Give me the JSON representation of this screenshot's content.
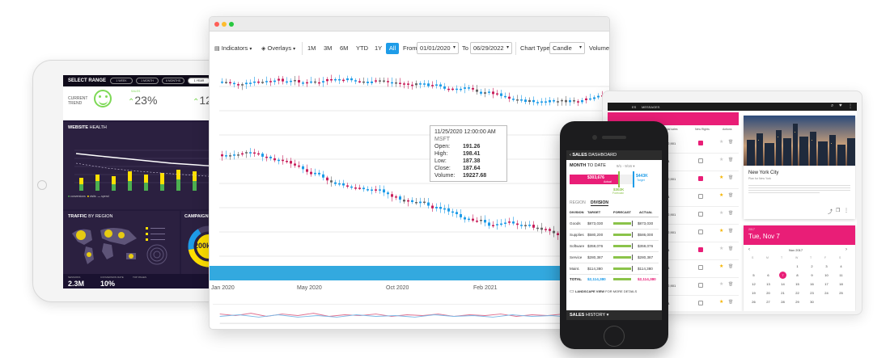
{
  "left_tablet": {
    "select_range": "SELECT RANGE",
    "ranges": [
      "1 WEEK",
      "1 MONTH",
      "6 MONTHS",
      "1 YEAR"
    ],
    "current_trend": "CURRENT TREND",
    "kpi1_label": "SALES",
    "kpi1_value": "23%",
    "kpi2_value": "12",
    "website_health_a": "WEBSITE",
    "website_health_b": "HEALTH",
    "legend": [
      "conversions",
      "visits",
      "spend"
    ],
    "traffic_a": "TRAFFIC",
    "traffic_b": "BY REGION",
    "campaign": "CAMPAIGN",
    "campaign_value": "200k",
    "footer": [
      {
        "label": "SESSIONS",
        "value": "2.3M"
      },
      {
        "label": "CONVERSION RATE",
        "value": "10%"
      },
      {
        "label": "TOP PAGES",
        "value": ""
      }
    ]
  },
  "browser": {
    "indicators": "Indicators",
    "overlays": "Overlays",
    "periods": [
      "1M",
      "3M",
      "6M",
      "YTD",
      "1Y",
      "All"
    ],
    "active_period": "All",
    "from_label": "From",
    "from_value": "01/01/2020",
    "to_label": "To",
    "to_value": "06/29/2022",
    "chart_type_label": "Chart Type",
    "chart_type_value": "Candle",
    "volume_label": "Volume",
    "tooltip": {
      "date": "11/25/2020 12:00:00 AM",
      "symbol": "MSFT",
      "rows": [
        {
          "k": "Open:",
          "v": "191.26"
        },
        {
          "k": "High:",
          "v": "198.41"
        },
        {
          "k": "Low:",
          "v": "187.38"
        },
        {
          "k": "Close:",
          "v": "187.64"
        },
        {
          "k": "Volume:",
          "v": "19227.68"
        }
      ]
    },
    "x_ticks": [
      "Jan 2020",
      "May 2020",
      "Oct 2020",
      "Feb 2021"
    ],
    "colors": {
      "up": "#1e9ce8",
      "down": "#c81e5a",
      "neutral": "#666666",
      "band": "#33a9df"
    }
  },
  "phone": {
    "header_a": "SALES",
    "header_b": "DASHBOARD",
    "month_a": "MONTH",
    "month_b": "TO DATE",
    "date_range": "9/1 - 9/16",
    "actual_value": "$303,676",
    "actual_label": "Actual",
    "target_value": "$443K",
    "target_label": "Target",
    "forecast_value": "$302K",
    "forecast_label": "Forecast",
    "region": "REGION",
    "division": "DIVISION",
    "cols": [
      "DIVISION",
      "TARGET",
      "FORECAST",
      "ACTUAL"
    ],
    "rows": [
      {
        "division": "Goods",
        "target": "$873,030",
        "actual": "$873,030"
      },
      {
        "division": "Supplies",
        "target": "$580,200",
        "actual": "$586,000"
      },
      {
        "division": "Software",
        "target": "$359,076",
        "actual": "$359,076"
      },
      {
        "division": "Service",
        "target": "$280,387",
        "actual": "$280,387"
      },
      {
        "division": "Maint.",
        "target": "$114,380",
        "actual": "$114,380"
      }
    ],
    "total_label": "TOTAL",
    "total_target": "$2,114,380",
    "total_actual": "$2,114,380",
    "landscape_note_a": "LANDSCAPE VIEW",
    "landscape_note_b": "FOR MORE DETAILS",
    "footer_a": "SALES",
    "footer_b": "HISTORY"
  },
  "right_tablet": {
    "topbar": [
      "ES",
      "MESSAGES"
    ],
    "cols": [
      "Total sales",
      "New Rights",
      "Actions"
    ],
    "rows": [
      {
        "v": "$2,901",
        "checked": true,
        "star": false
      },
      {
        "v": "$4",
        "checked": false,
        "star": false
      },
      {
        "v": "$2,901",
        "checked": true,
        "star": true
      },
      {
        "v": "$4",
        "checked": false,
        "star": true
      },
      {
        "v": "$2,901",
        "checked": false,
        "star": false
      },
      {
        "v": "$2,901",
        "checked": false,
        "star": true
      },
      {
        "v": "$4",
        "checked": true,
        "star": false
      },
      {
        "v": "$4",
        "checked": false,
        "star": true
      },
      {
        "v": "$2,901",
        "checked": false,
        "star": false
      },
      {
        "v": "$4",
        "checked": false,
        "star": true
      }
    ],
    "card_title": "New York City",
    "card_sub": "Plan for New York",
    "cal_year": "2017",
    "cal_date": "Tue, Nov 7",
    "cal_month": "Nov 2017",
    "weekdays": [
      "S",
      "M",
      "T",
      "W",
      "T",
      "F",
      "S"
    ],
    "selected_day": "7",
    "accent": "#e91e77"
  }
}
